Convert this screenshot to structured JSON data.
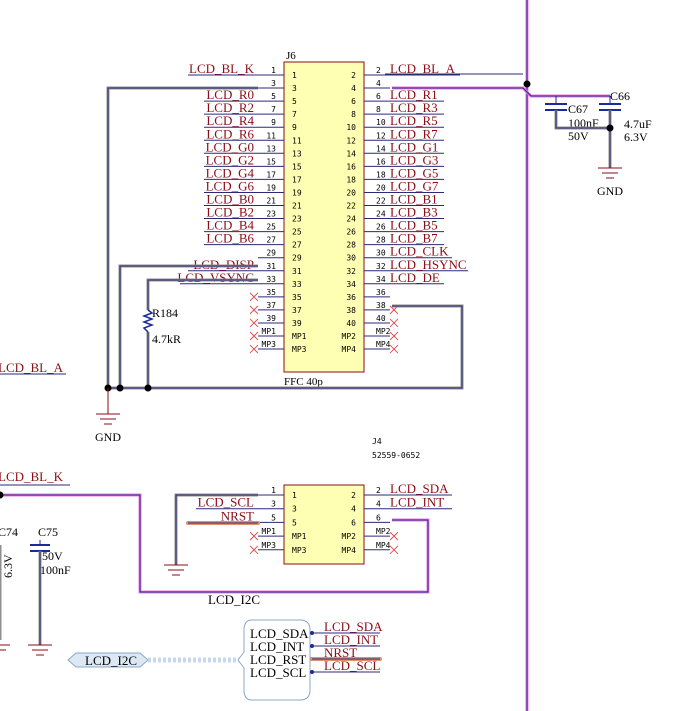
{
  "j6": {
    "designator": "J6",
    "footprint": "FFC 40p",
    "left_pins": [
      "1",
      "3",
      "5",
      "7",
      "9",
      "11",
      "13",
      "15",
      "17",
      "19",
      "21",
      "23",
      "25",
      "27",
      "29",
      "31",
      "33",
      "35",
      "37",
      "39",
      "MP1",
      "MP3"
    ],
    "right_pins": [
      "2",
      "4",
      "6",
      "8",
      "10",
      "12",
      "14",
      "16",
      "18",
      "20",
      "22",
      "24",
      "26",
      "28",
      "30",
      "32",
      "34",
      "36",
      "38",
      "40",
      "MP2",
      "MP4"
    ],
    "left_nets": [
      "LCD_BL_K",
      "",
      "LCD_R0",
      "LCD_R2",
      "LCD_R4",
      "LCD_R6",
      "LCD_G0",
      "LCD_G2",
      "LCD_G4",
      "LCD_G6",
      "LCD_B0",
      "LCD_B2",
      "LCD_B4",
      "LCD_B6",
      "",
      "LCD_DISP",
      "LCD_VSYNC"
    ],
    "right_nets": [
      "LCD_BL_A",
      "",
      "LCD_R1",
      "LCD_R3",
      "LCD_R5",
      "LCD_R7",
      "LCD_G1",
      "LCD_G3",
      "LCD_G5",
      "LCD_G7",
      "LCD_B1",
      "LCD_B3",
      "LCD_B5",
      "LCD_B7",
      "LCD_CLK",
      "LCD_HSYNC",
      "LCD_DE"
    ]
  },
  "j4": {
    "designator": "J4",
    "part_number": "52559-0652",
    "left_pins": [
      "1",
      "3",
      "5",
      "MP1",
      "MP3"
    ],
    "right_pins": [
      "2",
      "4",
      "6",
      "MP2",
      "MP4"
    ],
    "left_nets": [
      "",
      "LCD_SCL",
      "NRST"
    ],
    "right_nets": [
      "LCD_SDA",
      "LCD_INT",
      ""
    ]
  },
  "r184": {
    "designator": "R184",
    "value": "4.7kR"
  },
  "c67": {
    "designator": "C67",
    "value": "100nF",
    "voltage": "50V"
  },
  "c66": {
    "designator": "C66",
    "value": "4.7uF",
    "voltage": "6.3V"
  },
  "c74": {
    "designator": "C74",
    "voltage": "6.3V"
  },
  "c75": {
    "designator": "C75",
    "voltage": "50V",
    "value": "100nF"
  },
  "gnd": {
    "label": "GND"
  },
  "left_nets": {
    "bl_a": "LCD_BL_A",
    "bl_k": "LCD_BL_K"
  },
  "bus": {
    "name": "LCD_I2C",
    "members": [
      "LCD_SDA",
      "LCD_INT",
      "LCD_RST",
      "LCD_SCL"
    ],
    "outputs": [
      "LCD_SDA",
      "LCD_INT",
      "NRST",
      "LCD_SCL"
    ]
  },
  "colors": {
    "wire_net": "#8a0e14",
    "wire_highlight": "#e87ae8",
    "wire_gray": "#8f8f8f",
    "wire_nrst": "#e0906e",
    "component_fill": "#ffffb4",
    "bus_fill": "#dde8f5",
    "bus_stroke": "#8aa8c8",
    "gnd_color": "#8a0e14",
    "nc_cross": "#e05050"
  }
}
